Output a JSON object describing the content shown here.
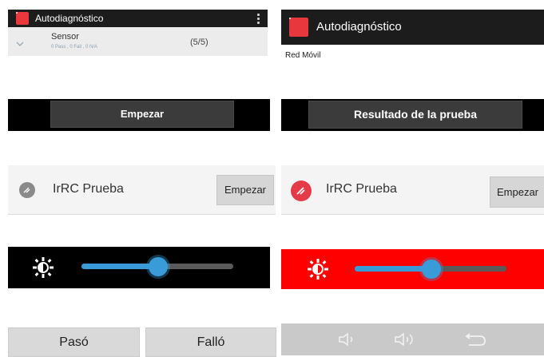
{
  "left": {
    "app_title": "Autodiagnóstico",
    "sensor": {
      "name": "Sensor",
      "summary": "0 Pass , 0 Fail , 0 N/A",
      "count": "(5/5)"
    },
    "start_button": "Empezar",
    "test": {
      "label": "IrRC Prueba",
      "button": "Empezar"
    },
    "pass_button": "Pasó",
    "fail_button": "Falló"
  },
  "right": {
    "app_title": "Autodiagnóstico",
    "subtitle": "Red Móvil",
    "result_button": "Resultado de la prueba",
    "test": {
      "label": "IrRC Prueba",
      "button": "Empezar"
    }
  },
  "brightness": {
    "left_level": 0.5,
    "right_level": 0.5
  },
  "colors": {
    "accent_red": "#e8383d",
    "slider_blue": "#3a9bd9",
    "bright_red_bar": "#ff0000"
  },
  "icons": {
    "brightness": "brightness-icon",
    "volume_down": "volume-down-icon",
    "volume_up": "volume-up-icon",
    "back": "back-icon"
  }
}
